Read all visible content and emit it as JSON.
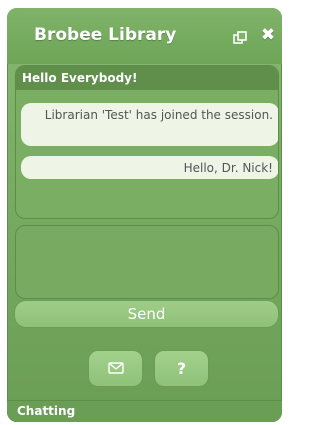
{
  "window": {
    "title": "Brobee Library",
    "popout_icon": "popout-icon",
    "close_label": "✖",
    "accent_color": "#78ab62"
  },
  "chat": {
    "header": "Hello Everybody!",
    "messages": [
      {
        "text": "Librarian 'Test' has joined the session."
      },
      {
        "text": "Hello, Dr. Nick!"
      }
    ]
  },
  "compose": {
    "value": "",
    "send_label": "Send"
  },
  "actions": {
    "mail_icon": "mail-icon",
    "help_label": "?"
  },
  "status": {
    "text": "Chatting"
  }
}
